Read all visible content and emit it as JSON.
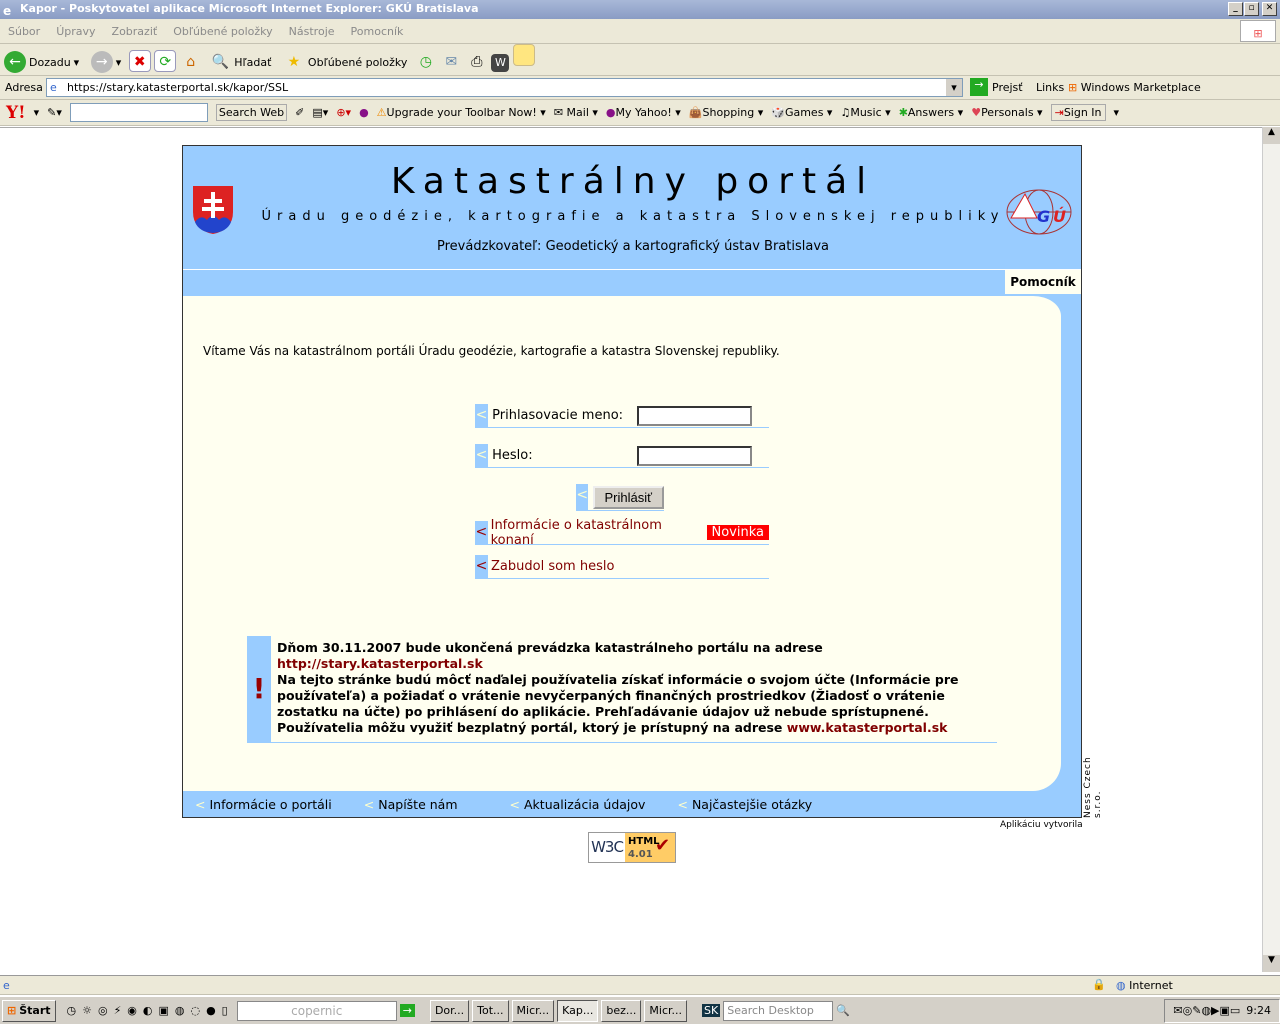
{
  "window": {
    "title": "Kapor - Poskytovatel aplikace Microsoft Internet Explorer: GKÚ Bratislava"
  },
  "menu": [
    "Súbor",
    "Úpravy",
    "Zobraziť",
    "Obľúbené položky",
    "Nástroje",
    "Pomocník"
  ],
  "toolbar": {
    "back": "Dozadu",
    "search": "Hľadať",
    "favorites": "Obľúbené položky"
  },
  "address": {
    "label": "Adresa",
    "url": "https://stary.katasterportal.sk/kapor/SSL",
    "go": "Prejsť",
    "links": "Links",
    "marketplace": "Windows Marketplace"
  },
  "yahoo": {
    "search_web": "Search Web",
    "upgrade": "Upgrade your Toolbar Now!",
    "items": [
      "Mail",
      "My Yahoo!",
      "Shopping",
      "Games",
      "Music",
      "Answers",
      "Personals"
    ],
    "sign_in": "Sign In"
  },
  "portal": {
    "title": "Katastrálny portál",
    "subtitle": "Úradu geodézie, kartografie a katastra Slovenskej republiky",
    "operator": "Prevádzkovateľ: Geodetický a kartografický ústav Bratislava",
    "help": "Pomocník",
    "welcome": "Vítame Vás na katastrálnom portáli Úradu geodézie, kartografie a katastra Slovenskej republiky.",
    "login_label": "Prihlasovacie meno:",
    "password_label": "Heslo:",
    "login_button": "Prihlásiť",
    "info_link": "Informácie o katastrálnom konaní",
    "new_badge": "Novinka",
    "forgot_link": "Zabudol som heslo",
    "notice": {
      "line1": "Dňom 30.11.2007 bude ukončená prevádzka katastrálneho portálu na adrese",
      "url1": "http://stary.katasterportal.sk",
      "body": "Na tejto stránke budú môcť naďalej používatelia získať informácie o svojom účte (Informácie pre používateľa) a požiadať o vrátenie nevyčerpaných finančných prostriedkov (Žiadosť o vrátenie zostatku na účte) po prihlásení do aplikácie. Prehľadávanie údajov už nebude sprístupnené. Používatelia môžu využiť bezplatný portál, ktorý je prístupný na adrese",
      "url2": "www.katasterportal.sk"
    },
    "footer": [
      "Informácie o portáli",
      "Napíšte nám",
      "Aktualizácia údajov",
      "Najčastejšie otázky"
    ],
    "vendor": "Ness Czech s.r.o.",
    "created_by": "Aplikáciu vytvorila",
    "w3c": {
      "left": "W3C",
      "top": "HTML",
      "bottom": "4.01"
    }
  },
  "status": {
    "zone": "Internet"
  },
  "taskbar": {
    "start": "Štart",
    "copernic": "copernic",
    "tasks": [
      "Dor...",
      "Tot...",
      "Micr...",
      "Kap...",
      "bez...",
      "Micr..."
    ],
    "search_desktop": "Search Desktop",
    "clock": "9:24"
  },
  "colors": {
    "header_bg": "#99ccff",
    "content_bg": "#fffff0",
    "link": "#800000",
    "badge": "#ff0000"
  }
}
